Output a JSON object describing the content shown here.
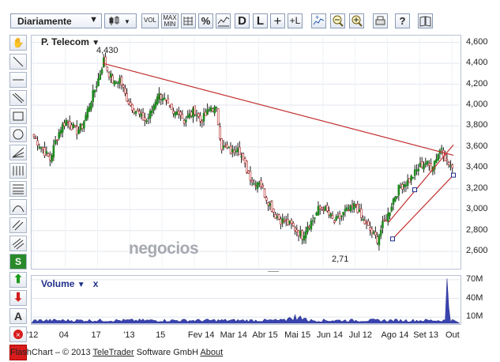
{
  "toolbar": {
    "period_select": "Diariamente",
    "buttons": [
      {
        "name": "candlestick-type-button",
        "label": "",
        "icon": "candlestick-icon"
      },
      {
        "name": "vol-button",
        "label": "VOL"
      },
      {
        "name": "max-min-button",
        "label": "MAX MIN"
      },
      {
        "name": "grid-button",
        "label": "",
        "icon": "grid-icon"
      },
      {
        "name": "percent-button",
        "label": "%"
      },
      {
        "name": "line-chart-button",
        "label": "",
        "icon": "line-chart-icon"
      },
      {
        "name": "d-button",
        "label": "D"
      },
      {
        "name": "l-button",
        "label": "L"
      },
      {
        "name": "crosshair-button",
        "label": "+"
      },
      {
        "name": "crosshair-l-button",
        "label": "+L"
      },
      {
        "name": "indicator-add-button",
        "label": "",
        "icon": "indicator-add-icon"
      },
      {
        "name": "zoom-out-button",
        "label": "",
        "icon": "zoom-out-icon"
      },
      {
        "name": "zoom-in-button",
        "label": "",
        "icon": "zoom-in-icon"
      },
      {
        "name": "print-button",
        "label": "",
        "icon": "print-icon"
      },
      {
        "name": "help-button",
        "label": "?"
      },
      {
        "name": "book-button",
        "label": "",
        "icon": "book-icon"
      }
    ]
  },
  "leftbar": {
    "tools": [
      "hand-icon",
      "line-icon",
      "horizontal-line-icon",
      "parallel-icon",
      "rectangle-icon",
      "circle-icon",
      "fan-icon",
      "vertical-lines-icon",
      "horizontal-lines-icon",
      "arc-icon",
      "diagonal-lines-icon",
      "channel-icon",
      "signal-s-icon",
      "buy-arrow-icon",
      "sell-arrow-icon",
      "text-tool-icon",
      "delete-icon",
      "color-icon"
    ]
  },
  "chart_data": {
    "type": "candlestick",
    "title": "P. Telecom",
    "y_ticks": [
      "4,600",
      "4,400",
      "4,200",
      "4,000",
      "3,800",
      "3,600",
      "3,400",
      "3,200",
      "3,000",
      "2,800",
      "2,600"
    ],
    "ylim": [
      2.45,
      4.65
    ],
    "x_ticks": [
      "12",
      "04",
      "17",
      "13",
      "15",
      "Feb 14",
      "Mar 14",
      "Abr 15",
      "Mai 15",
      "Jun 14",
      "Jul 12",
      "Ago 14",
      "Set 13",
      "Out"
    ],
    "annotations": [
      "4,430",
      "2,71"
    ],
    "high_value": 4.43,
    "low_value": 2.71,
    "series": [
      {
        "name": "P. Telecom",
        "close_approx": [
          3.7,
          3.62,
          3.55,
          3.48,
          3.65,
          3.78,
          3.85,
          3.8,
          3.75,
          3.8,
          3.95,
          4.1,
          4.25,
          4.43,
          4.3,
          4.2,
          4.25,
          4.1,
          4.0,
          3.95,
          3.88,
          3.85,
          3.95,
          4.1,
          4.08,
          3.98,
          3.9,
          3.95,
          3.85,
          3.9,
          3.95,
          3.85,
          3.9,
          3.98,
          3.95,
          3.6,
          3.58,
          3.55,
          3.62,
          3.45,
          3.35,
          3.25,
          3.28,
          3.15,
          3.05,
          2.95,
          2.9,
          2.88,
          2.85,
          2.8,
          2.75,
          2.85,
          2.9,
          3.0,
          3.02,
          2.95,
          2.88,
          2.92,
          2.98,
          3.0,
          3.05,
          2.92,
          2.85,
          2.78,
          2.72,
          2.85,
          2.95,
          3.1,
          3.2,
          3.25,
          3.28,
          3.35,
          3.42,
          3.45,
          3.4,
          3.5,
          3.6,
          3.45,
          3.4
        ]
      }
    ],
    "volume": {
      "title": "Volume",
      "y_ticks": [
        "70M",
        "40M",
        "10M"
      ],
      "ylim": [
        0,
        75
      ]
    }
  },
  "x_ticks_display": [
    "'12",
    "04",
    "17",
    "'13",
    "15",
    "Fev 14",
    "Mar 14",
    "Abr 15",
    "Mai 15",
    "Jun 14",
    "Jul 12",
    "Ago 14",
    "Set 13",
    "Out"
  ],
  "watermark": "negocios",
  "footer": {
    "text": "FlashChart – © 2013",
    "link1": "TeleTrader",
    "mid": "Software GmbH",
    "link2": "About"
  }
}
